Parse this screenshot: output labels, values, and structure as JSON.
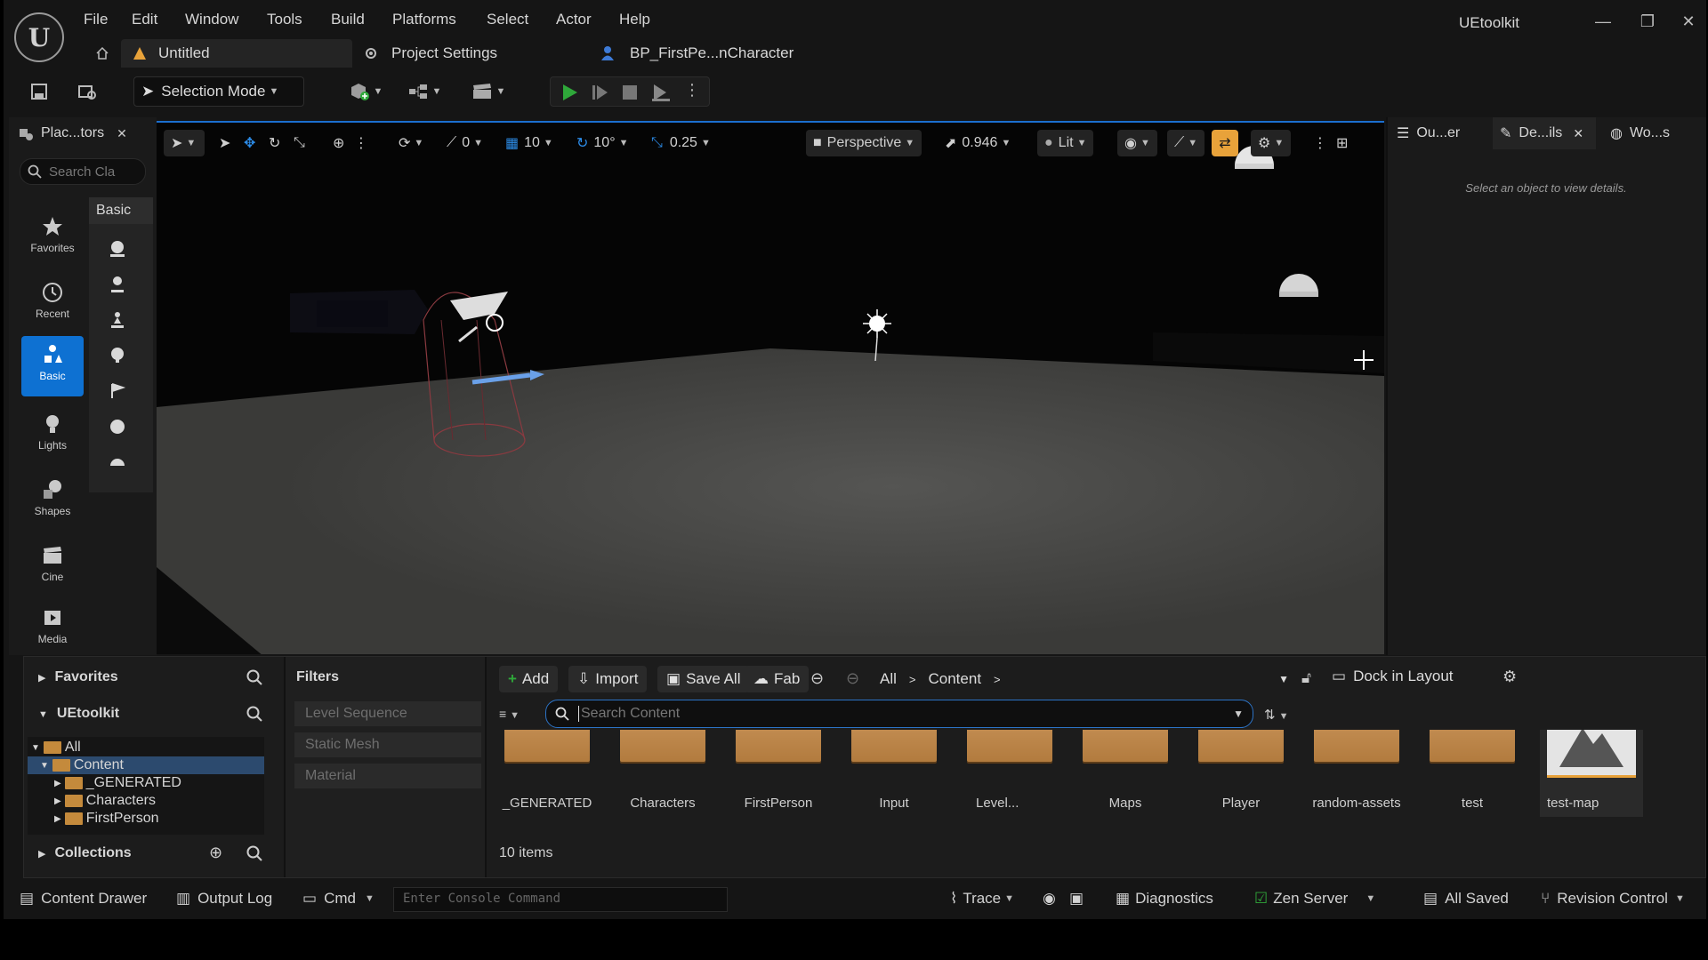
{
  "app": {
    "name": "UEtoolkit"
  },
  "menu": [
    "File",
    "Edit",
    "Window",
    "Tools",
    "Build",
    "Platforms",
    "Select",
    "Actor",
    "Help"
  ],
  "tabs": [
    {
      "label": "Untitled"
    },
    {
      "label": "Project Settings"
    },
    {
      "label": "BP_FirstPe...nCharacter"
    }
  ],
  "toolbar": {
    "selection_mode": "Selection Mode"
  },
  "place_actors": {
    "tab_label": "Plac...tors",
    "search_placeholder": "Search Cla",
    "active_header": "Basic",
    "categories": [
      "Favorites",
      "Recent",
      "Basic",
      "Lights",
      "Shapes",
      "Cine",
      "Media"
    ]
  },
  "viewport": {
    "snap_angle_value": "0",
    "grid_value": "10",
    "rotate_value": "10°",
    "scale_value": "0.25",
    "perspective": "Perspective",
    "camera_speed": "0.946",
    "view_mode": "Lit"
  },
  "details": {
    "tabs": [
      "Ou...er",
      "De...ils",
      "Wo...s"
    ],
    "empty_message": "Select an object to view details."
  },
  "content_browser": {
    "favorites_label": "Favorites",
    "project_label": "UEtoolkit",
    "collections_label": "Collections",
    "tree": [
      "All",
      "Content",
      "_GENERATED",
      "Characters",
      "FirstPerson"
    ],
    "filters_title": "Filters",
    "filters": [
      "Level Sequence",
      "Static Mesh",
      "Material"
    ],
    "buttons": {
      "add": "Add",
      "import": "Import",
      "save_all": "Save All",
      "fab": "Fab",
      "dock": "Dock in Layout"
    },
    "breadcrumb": [
      "All",
      "Content"
    ],
    "search_placeholder": "Search Content",
    "items": [
      "_GENERATED",
      "Characters",
      "FirstPerson",
      "Input",
      "Level...",
      "Maps",
      "Player",
      "random-assets",
      "test",
      "test-map"
    ],
    "item_count": "10 items"
  },
  "statusbar": {
    "content_drawer": "Content Drawer",
    "output_log": "Output Log",
    "cmd": "Cmd",
    "console_placeholder": "Enter Console Command",
    "trace": "Trace",
    "diagnostics": "Diagnostics",
    "zen": "Zen Server",
    "all_saved": "All Saved",
    "revision": "Revision Control"
  },
  "colors": {
    "accent": "#0e71d2",
    "play": "#2fa83a",
    "folder": "#c48a3c",
    "selection": "#e8a23a"
  }
}
